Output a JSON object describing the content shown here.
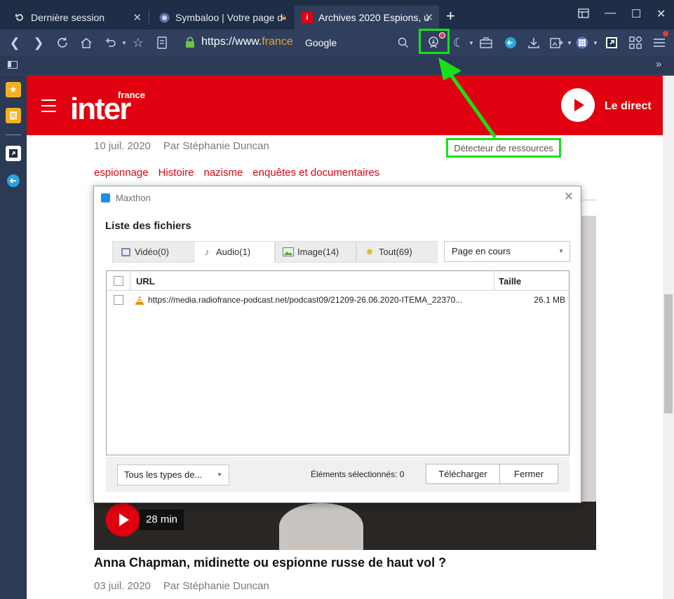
{
  "tabs": [
    {
      "title": "Dernière session",
      "active": false
    },
    {
      "title": "Symbaloo | Votre page d",
      "active": false
    },
    {
      "title": "Archives 2020 Espions, u",
      "active": true
    }
  ],
  "address": {
    "prefix": "https://www.",
    "domain": "france",
    "search_engine": "Google"
  },
  "page": {
    "brand": {
      "top": "france",
      "name": "inter"
    },
    "live_label": "Le direct",
    "article1": {
      "date": "10 juil. 2020",
      "author": "Par  Stéphanie Duncan"
    },
    "tags": [
      "espionnage",
      "Histoire",
      "nazisme",
      "enquêtes et documentaires"
    ],
    "podcast": {
      "duration": "28 min"
    },
    "article2": {
      "title": "Anna Chapman, midinette ou espionne russe de haut vol ?",
      "date": "03 juil. 2020",
      "author": "Par  Stéphanie Duncan"
    }
  },
  "annotation": {
    "label": "Détecteur de ressources",
    "color": "#18e018"
  },
  "dialog": {
    "title": "Maxthon",
    "heading": "Liste des fichiers",
    "tabs": [
      {
        "label": "Vidéo(0)",
        "icon": "film-icon"
      },
      {
        "label": "Audio(1)",
        "icon": "music-note-icon"
      },
      {
        "label": "Image(14)",
        "icon": "image-icon"
      },
      {
        "label": "Tout(69)",
        "icon": "puzzle-icon"
      }
    ],
    "scope": "Page en cours",
    "columns": {
      "url": "URL",
      "size": "Taille"
    },
    "files": [
      {
        "url": "https://media.radiofrance-podcast.net/podcast09/21209-26.06.2020-ITEMA_22370...",
        "size": "26.1 MB"
      }
    ],
    "type_filter": "Tous les types de...",
    "selected": "Éléments sélectionnés: 0",
    "download": "Télécharger",
    "close": "Fermer"
  },
  "colors": {
    "brand_red": "#e1000f",
    "chrome": "#2f3f5d",
    "highlight": "#18e018"
  }
}
